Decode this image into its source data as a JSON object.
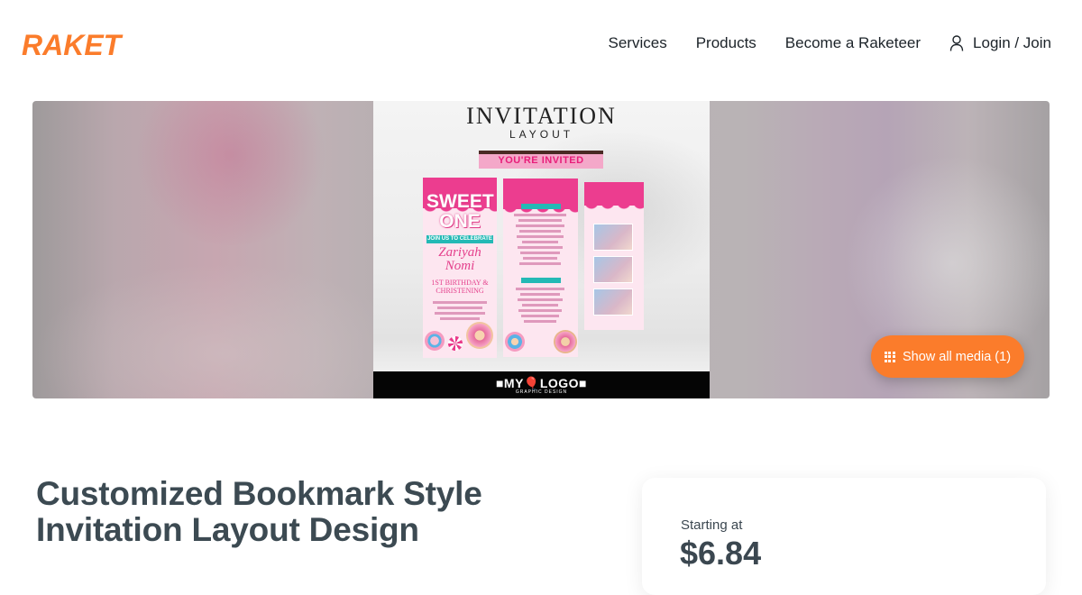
{
  "header": {
    "logo_text": "RAKET",
    "brand_color": "#fb7c2b",
    "nav": {
      "services": "Services",
      "products": "Products",
      "become": "Become a Raketeer",
      "login": "Login / Join"
    }
  },
  "hero": {
    "poster": {
      "title": "INVITATION",
      "subtitle": "LAYOUT",
      "invited": "YOU'RE INVITED",
      "sweet_one": "SWEET ONE",
      "join": "JOIN US TO CELEBRATE",
      "name": "Zariyah Nomi",
      "occasion": "1ST BIRTHDAY & CHRISTENING",
      "brand": "■MY🎈LOGO■",
      "brand_sub": "GRAPHIC DESIGN"
    },
    "show_media_label": "Show all media (1)"
  },
  "listing": {
    "title": "Customized Bookmark Style Invitation Layout Design",
    "starting_label": "Starting at",
    "price": "$6.84"
  }
}
